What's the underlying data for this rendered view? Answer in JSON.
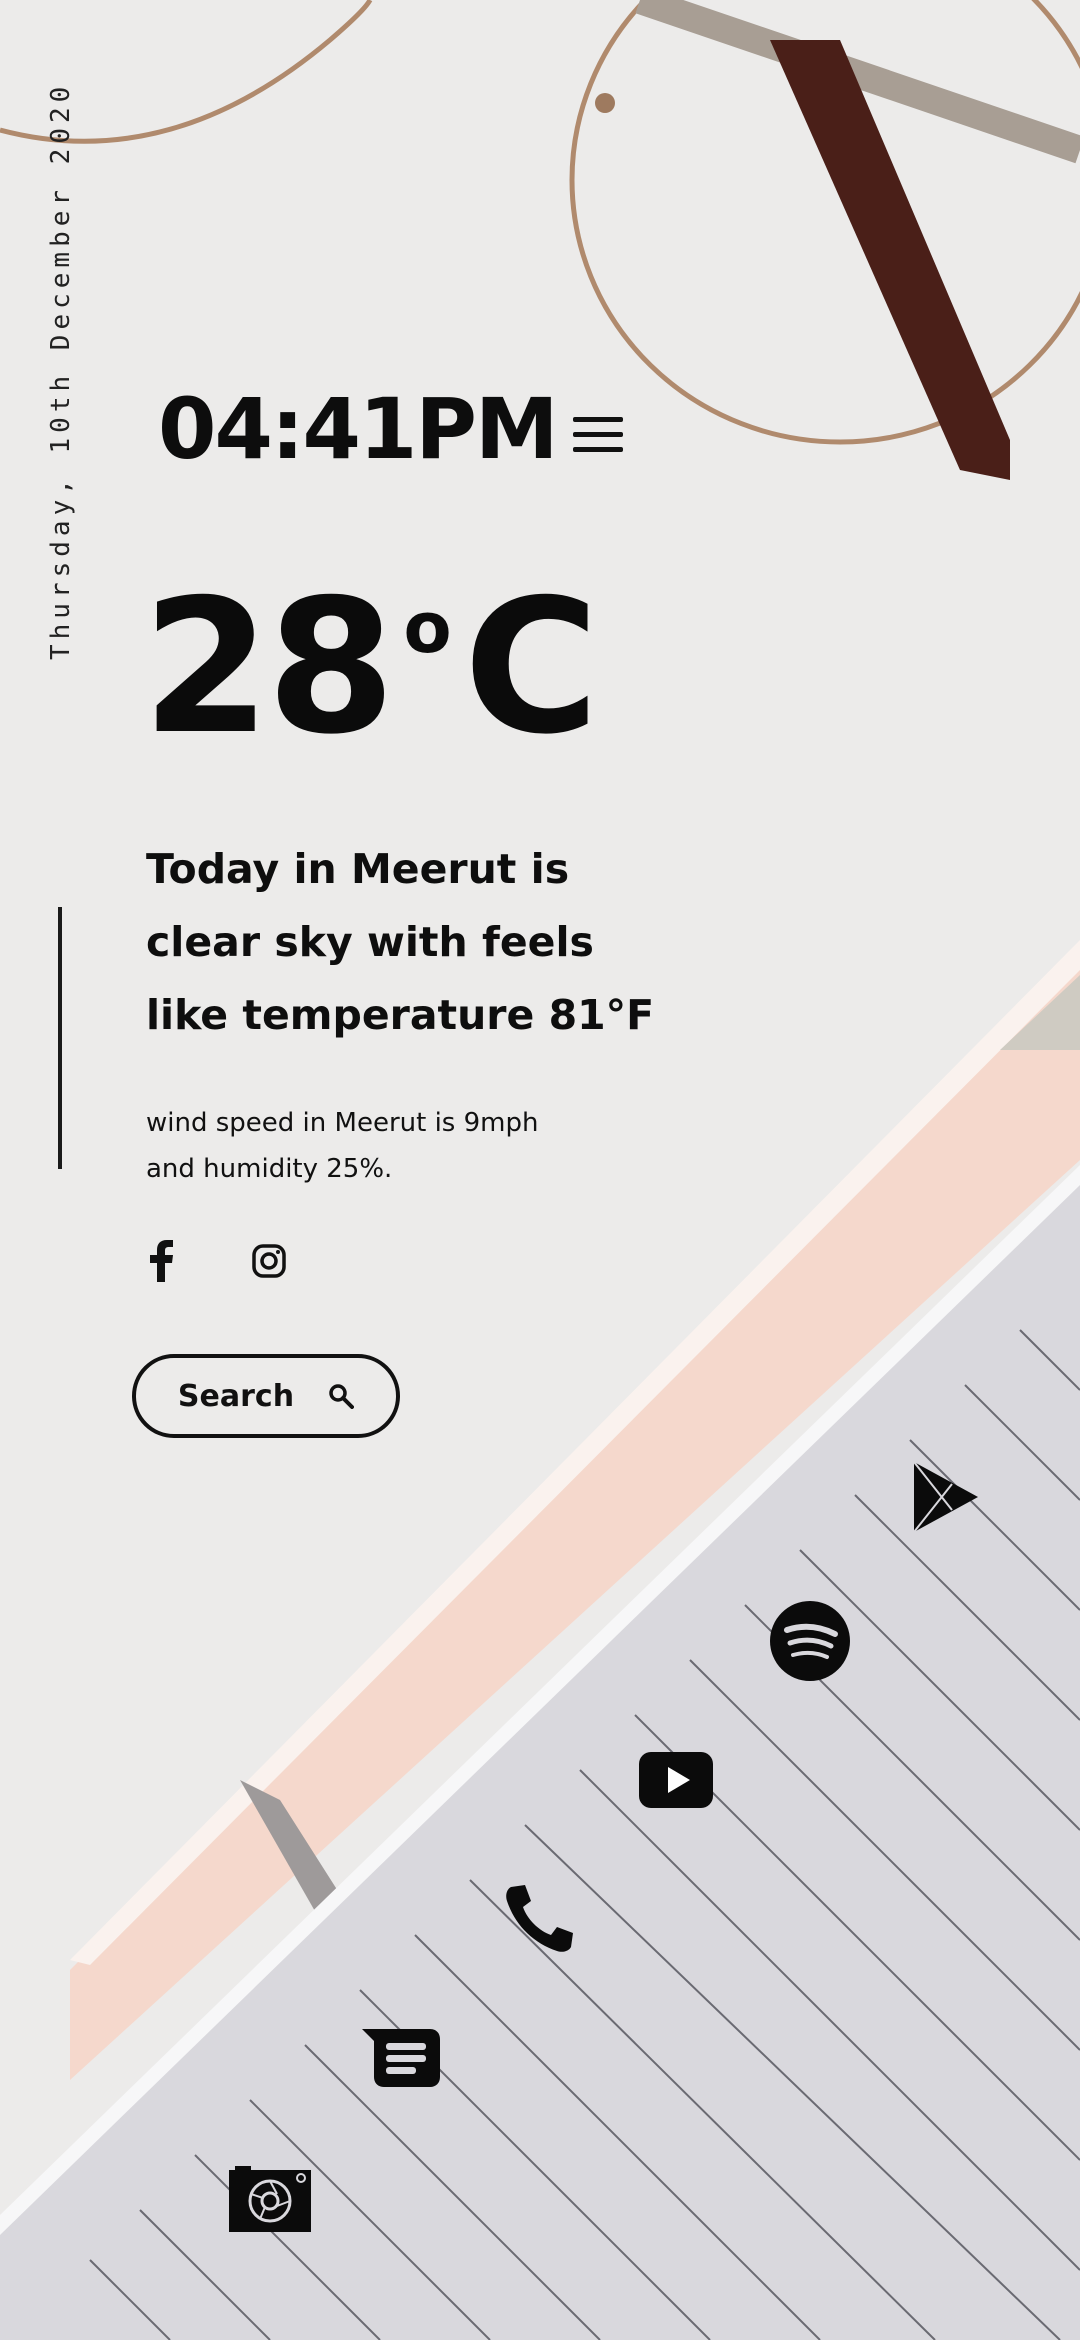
{
  "widget": {
    "date": "Thursday, 10th December 2020",
    "time": "04:41PM",
    "temperature": "28",
    "unit": "C",
    "headline": "Today in Meerut is clear sky with feels like temperature 81°F",
    "details": "wind speed in Meerut is 9mph and humidity 25%.",
    "search_label": "Search"
  },
  "social": [
    "facebook-icon",
    "instagram-icon"
  ],
  "apps": [
    "google-play-icon",
    "spotify-icon",
    "youtube-icon",
    "phone-icon",
    "messages-icon",
    "camera-icon"
  ],
  "colors": {
    "ink": "#0d0d0d",
    "paper": "#ecebea",
    "notebook": "#d9d8dd",
    "peach": "#f5d8cc"
  }
}
